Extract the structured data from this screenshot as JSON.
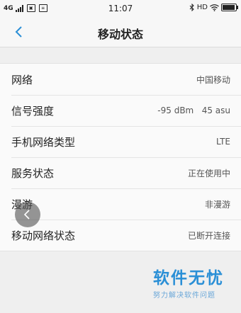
{
  "status_bar": {
    "network": "4G",
    "time": "11:07",
    "right_text": "HD",
    "battery_level": 0.92
  },
  "header": {
    "title": "移动状态"
  },
  "rows": [
    {
      "label": "网络",
      "value": "中国移动"
    },
    {
      "label": "信号强度",
      "value": "-95 dBm   45 asu"
    },
    {
      "label": "手机网络类型",
      "value": "LTE"
    },
    {
      "label": "服务状态",
      "value": "正在使用中"
    },
    {
      "label": "漫游",
      "value": "非漫游"
    },
    {
      "label": "移动网络状态",
      "value": "已断开连接"
    }
  ],
  "watermark": {
    "title": "软件无忧",
    "subtitle": "努力解决软件问题"
  },
  "colors": {
    "accent": "#2a8fd6",
    "background": "#efefef"
  },
  "icons": [
    "back-arrow-icon",
    "bluetooth-icon",
    "wifi-icon",
    "battery-icon",
    "floating-back-icon"
  ]
}
